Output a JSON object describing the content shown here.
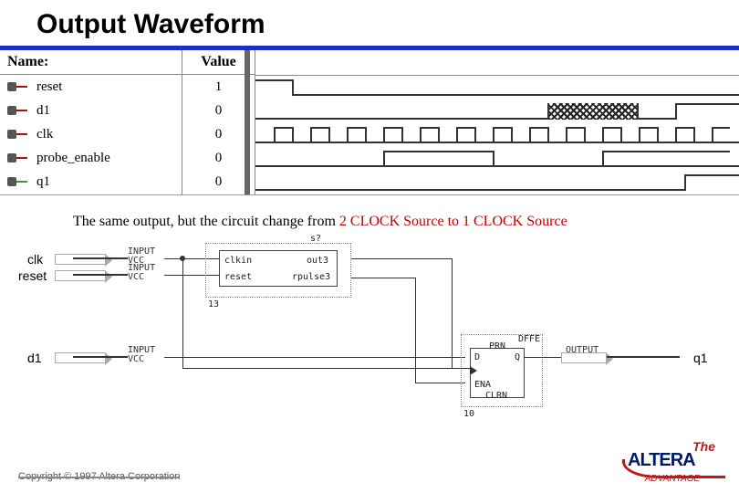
{
  "title": "Output Waveform",
  "waveform": {
    "name_header": "Name:",
    "value_header": "Value",
    "signals": [
      {
        "name": "reset",
        "value": "1",
        "dir": "in"
      },
      {
        "name": "d1",
        "value": "0",
        "dir": "in"
      },
      {
        "name": "clk",
        "value": "0",
        "dir": "in"
      },
      {
        "name": "probe_enable",
        "value": "0",
        "dir": "in"
      },
      {
        "name": "q1",
        "value": "0",
        "dir": "out"
      }
    ]
  },
  "caption": {
    "plain": "The same output,  but the circuit change from ",
    "red": "2 CLOCK Source to 1 CLOCK Source"
  },
  "schematic": {
    "inputs": {
      "clk": {
        "label": "clk",
        "tag": "INPUT",
        "vcc": "VCC"
      },
      "reset": {
        "label": "reset",
        "tag": "INPUT",
        "vcc": "VCC"
      },
      "d1": {
        "label": "d1",
        "tag": "INPUT",
        "vcc": "VCC"
      }
    },
    "counter_block": {
      "inst": "s?",
      "port_in1": "clkin",
      "port_in2": "reset",
      "port_out1": "out3",
      "port_out2": "rpulse3",
      "id": "13"
    },
    "dff_block": {
      "type": "DFFE",
      "d": "D",
      "q": "Q",
      "prn": "PRN",
      "ena": "ENA",
      "clrn": "CLRN",
      "id": "10"
    },
    "output": {
      "tag": "OUTPUT",
      "label": "q1"
    }
  },
  "footer": {
    "copyright": "Copyright © 1997 Altera Corporation",
    "logo": {
      "the": "The",
      "brand": "ALTERA",
      "tag": "ADVANTAGE"
    }
  }
}
